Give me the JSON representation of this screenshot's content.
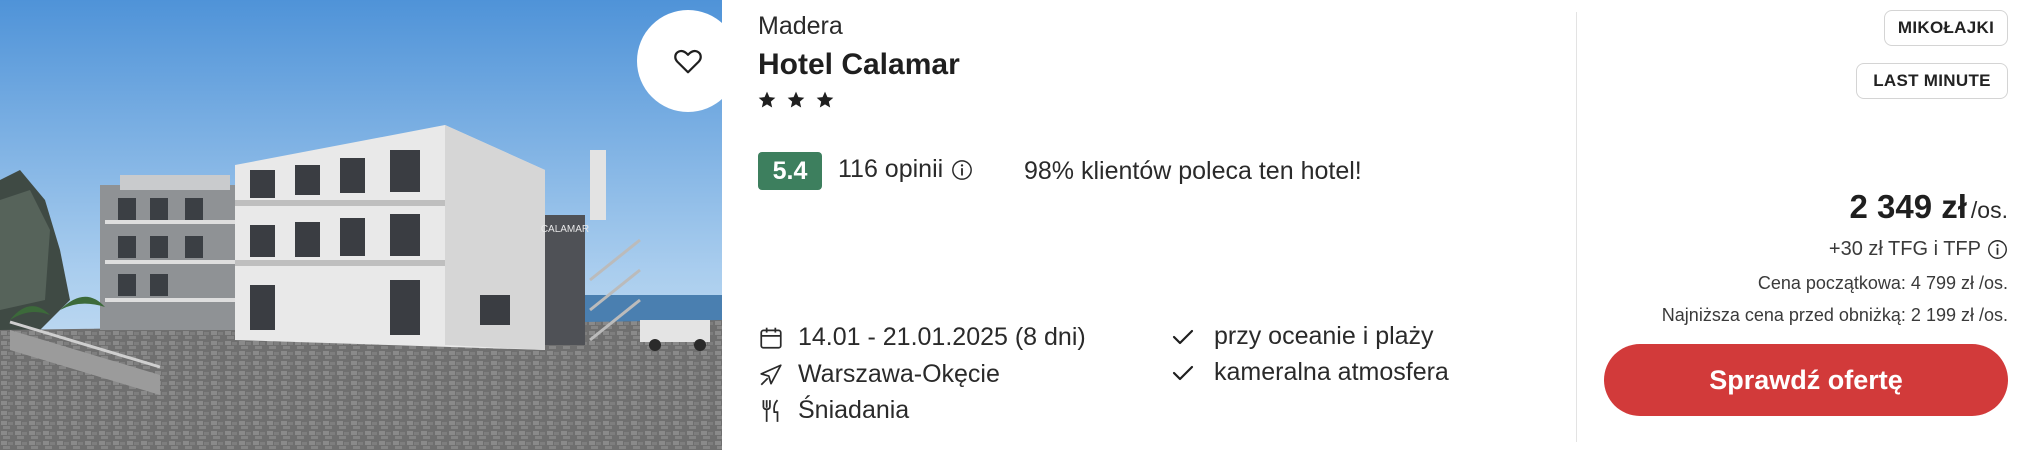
{
  "hotel": {
    "region": "Madera",
    "name": "Hotel Calamar",
    "stars": 3
  },
  "rating": {
    "score": "5.4",
    "reviews": "116 opinii",
    "recommend": "98% klientów poleca ten hotel!",
    "badge_color": "#3d7f5e"
  },
  "trip": {
    "dates": "14.01 - 21.01.2025 (8 dni)",
    "airport": "Warszawa-Okęcie",
    "board": "Śniadania"
  },
  "features": [
    "przy oceanie i plaży",
    "kameralna atmosfera"
  ],
  "tags": [
    "MIKOŁAJKI",
    "LAST MINUTE"
  ],
  "price": {
    "amount": "2 349 zł",
    "unit": "/os.",
    "fees": "+30 zł TFG i TFP",
    "base": "Cena początkowa: 4 799 zł /os.",
    "lowest": "Najniższa cena przed obniżką: 2 199 zł /os."
  },
  "cta": {
    "label": "Sprawdź ofertę",
    "color": "#d23a3a"
  },
  "photo": {
    "sign_text": "CALAMAR"
  },
  "icons": {
    "favorite": "heart-icon",
    "star": "star-icon",
    "info": "info-icon",
    "calendar": "calendar-icon",
    "plane": "plane-icon",
    "board": "fork-knife-icon",
    "check": "check-icon"
  }
}
